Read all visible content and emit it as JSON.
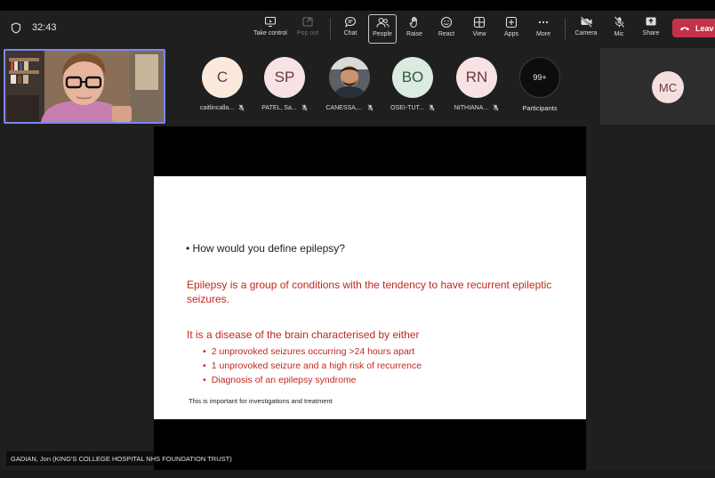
{
  "meeting": {
    "timer": "32:43"
  },
  "toolbar": {
    "buttons": [
      {
        "id": "take-control",
        "label": "Take control",
        "icon": "take-control-icon",
        "enabled": true
      },
      {
        "id": "pop-out",
        "label": "Pop out",
        "icon": "pop-out-icon",
        "enabled": false
      },
      {
        "id": "chat",
        "label": "Chat",
        "icon": "chat-icon",
        "enabled": true
      },
      {
        "id": "people",
        "label": "People",
        "icon": "people-icon",
        "enabled": true,
        "active": true
      },
      {
        "id": "raise",
        "label": "Raise",
        "icon": "hand-icon",
        "enabled": true
      },
      {
        "id": "react",
        "label": "React",
        "icon": "smiley-icon",
        "enabled": true
      },
      {
        "id": "view",
        "label": "View",
        "icon": "grid-icon",
        "enabled": true
      },
      {
        "id": "apps",
        "label": "Apps",
        "icon": "plus-box-icon",
        "enabled": true
      },
      {
        "id": "more",
        "label": "More",
        "icon": "ellipsis-icon",
        "enabled": true
      },
      {
        "id": "camera",
        "label": "Camera",
        "icon": "camera-off-icon",
        "enabled": true
      },
      {
        "id": "mic",
        "label": "Mic",
        "icon": "mic-off-icon",
        "enabled": true
      },
      {
        "id": "share",
        "label": "Share",
        "icon": "share-icon",
        "enabled": true
      }
    ],
    "leave_label": "Leav"
  },
  "participants": [
    {
      "initials": "C",
      "name": "caitlincalla...",
      "color": "#fbe9dc",
      "muted": true
    },
    {
      "initials": "SP",
      "name": "PATEL, Sa...",
      "color": "#f7e3e3",
      "muted": true
    },
    {
      "initials": "",
      "name": "CANESSA,...",
      "photo": true,
      "muted": true
    },
    {
      "initials": "BO",
      "name": "OSEI-TUT...",
      "color": "#dcebdf",
      "muted": true
    },
    {
      "initials": "RN",
      "name": "NITHIANA...",
      "color": "#f7e3e3",
      "muted": true
    }
  ],
  "overflow": {
    "count": "99+",
    "label": "Participants"
  },
  "side_participant": {
    "initials": "MC",
    "color": "#f4dfdf"
  },
  "slide": {
    "question": "• How would you define epilepsy?",
    "definition": "Epilepsy is a group of conditions with the tendency to have recurrent epileptic seizures.",
    "lead": "It is a disease of the brain characterised by either",
    "bullets": [
      "2 unprovoked seizures occurring >24 hours apart",
      "1 unprovoked seizure and a high risk of recurrence",
      "Diagnosis of an epilepsy syndrome"
    ],
    "note": "This is important for investigations and treatment",
    "accent_color": "#c0281f"
  },
  "presenter_tag": "GADIAN, Jon (KING'S COLLEGE HOSPITAL NHS FOUNDATION TRUST)"
}
